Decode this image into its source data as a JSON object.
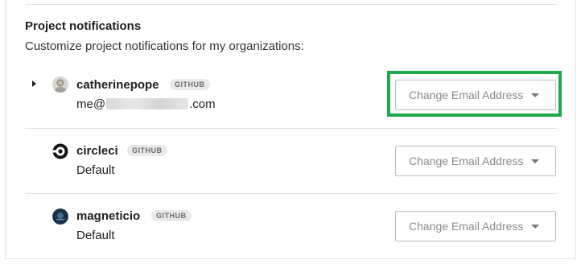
{
  "section": {
    "title": "Project notifications",
    "subtitle": "Customize project notifications for my organizations:"
  },
  "orgs": [
    {
      "name": "catherinepope",
      "badge": "GITHUB",
      "email_prefix": "me@",
      "email_suffix": ".com",
      "select_label": "Change Email Address",
      "avatar_icon": "user-avatar-photo",
      "expanded": false
    },
    {
      "name": "circleci",
      "badge": "GITHUB",
      "detail": "Default",
      "select_label": "Change Email Address",
      "avatar_icon": "circleci-logo"
    },
    {
      "name": "magneticio",
      "badge": "GITHUB",
      "detail": "Default",
      "select_label": "Change Email Address",
      "avatar_icon": "magneticio-logo"
    }
  ],
  "colors": {
    "highlight": "#1fa84a",
    "badge_bg": "#e9e9e9",
    "text": "#212121"
  }
}
